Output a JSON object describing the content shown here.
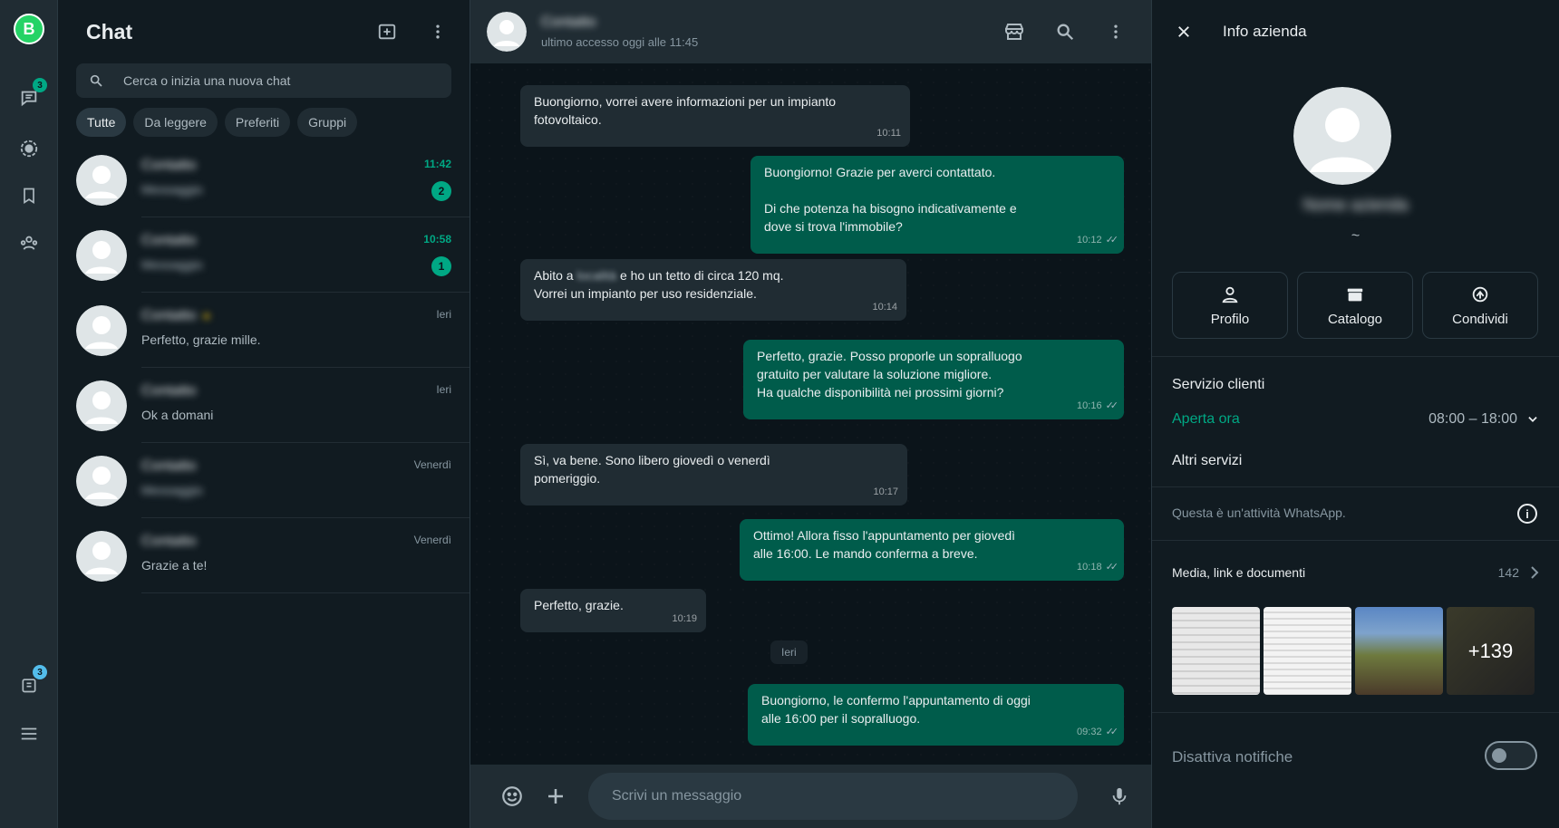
{
  "rail": {
    "chats_badge": "3",
    "archive_badge": "3",
    "logo_letter": "B"
  },
  "list": {
    "title": "Chat",
    "search_placeholder": "Cerca o inizia una nuova chat",
    "filters": [
      "Tutte",
      "Da leggere",
      "Preferiti",
      "Gruppi"
    ],
    "rows": [
      {
        "name": "Contatto",
        "preview": "Messaggio",
        "time": "11:42",
        "unread": "2"
      },
      {
        "name": "Contatto",
        "preview": "Messaggio",
        "time": "10:58",
        "unread": "1"
      },
      {
        "name": "Contatto",
        "preview": "Perfetto, grazie mille.",
        "time": "Ieri",
        "unread": ""
      },
      {
        "name": "Contatto",
        "preview": "Ok a domani",
        "time": "Ieri",
        "unread": ""
      },
      {
        "name": "Contatto",
        "preview": "Messaggio",
        "time": "Venerdì",
        "unread": ""
      },
      {
        "name": "Contatto",
        "preview": "Grazie a te!",
        "time": "Venerdì",
        "unread": ""
      }
    ]
  },
  "conversation": {
    "contact_name": "Contatto",
    "status": "ultimo accesso oggi alle 11:45",
    "messages": [
      {
        "dir": "in",
        "text": "Buongiorno, vorrei avere informazioni per un impianto\nfotovoltaico.",
        "time": "10:11"
      },
      {
        "dir": "out",
        "text": "Buongiorno! Grazie per averci contattato.\n\nDi che potenza ha bisogno indicativamente e\ndove si trova l'immobile?",
        "time": "10:12"
      },
      {
        "dir": "in",
        "text_a": "Abito a ",
        "text_redacted": "località",
        "text_b": " e ho un tetto di circa 120 mq.\nVorrei un impianto per uso residenziale.",
        "time": "10:14"
      },
      {
        "dir": "out",
        "text": "Perfetto, grazie. Posso proporle un sopralluogo\ngratuito per valutare la soluzione migliore.\nHa qualche disponibilità nei prossimi giorni?",
        "time": "10:16"
      },
      {
        "dir": "in",
        "text": "Sì, va bene. Sono libero giovedì o venerdì\npomeriggio.",
        "time": "10:17"
      },
      {
        "dir": "out",
        "text": "Ottimo! Allora fisso l'appuntamento per giovedì\nalle 16:00. Le mando conferma a breve.",
        "time": "10:18"
      },
      {
        "dir": "in",
        "text": "Perfetto, grazie.",
        "time": "10:19"
      },
      {
        "dir": "out",
        "text": "Buongiorno, le confermo l'appuntamento di oggi\nalle 16:00 per il sopralluogo.",
        "time": "09:32"
      }
    ],
    "day_separator": "Ieri",
    "composer_placeholder": "Scrivi un messaggio"
  },
  "info": {
    "title": "Info azienda",
    "business_name": "Nome azienda",
    "tilde": "~",
    "actions": [
      "Profilo",
      "Catalogo",
      "Condividi"
    ],
    "customer_service": "Servizio clienti",
    "open_now": "Aperta ora",
    "hours": "08:00 – 18:00",
    "other_services": "Altri servizi",
    "note": "Questa è un'attività WhatsApp.",
    "media_label": "Media, link e documenti",
    "media_count": "142",
    "more_media": "+139",
    "mute_label": "Disattiva notifiche"
  },
  "colors": {
    "accent": "#00a884",
    "outgoing_bubble": "#005c4b",
    "incoming_bubble": "#202c33",
    "panel_bg": "#111b21"
  }
}
